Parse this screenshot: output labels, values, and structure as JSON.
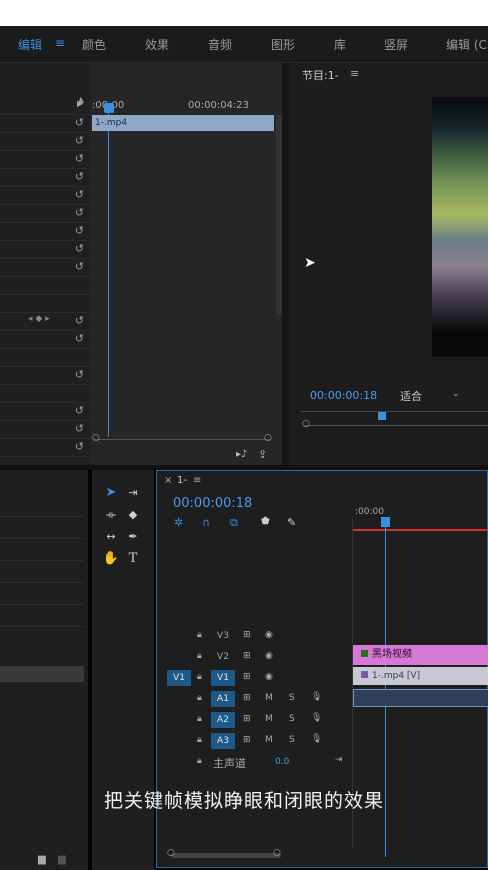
{
  "workspace_tabs": [
    "编辑",
    "≡",
    "颜色",
    "效果",
    "音频",
    "图形",
    "库",
    "竖屏",
    "编辑 (C"
  ],
  "effect_controls": {
    "time_start": ":00:00",
    "time_end": "00:00:04:23",
    "clip_label": "1-.mp4",
    "reset_icon": "↺"
  },
  "program": {
    "title": "节目:1-",
    "menu": "≡",
    "timecode": "00:00:00:18",
    "fit_label": "适合"
  },
  "sequence": {
    "tab_close": "×",
    "tab_name": "1-",
    "tab_menu": "≡",
    "timecode": "00:00:00:18",
    "ruler_time": ":00:00",
    "tracks": [
      {
        "src": "",
        "name": "V3"
      },
      {
        "src": "",
        "name": "V2"
      },
      {
        "src": "V1",
        "name": "V1"
      },
      {
        "src": "",
        "name": "A1"
      },
      {
        "src": "",
        "name": "A2"
      },
      {
        "src": "",
        "name": "A3"
      }
    ],
    "master_label": "主声道",
    "master_value": "0.0",
    "clip_v2": "黑场视频",
    "clip_v1": "1-.mp4 [V]",
    "mute": "M",
    "solo": "S"
  },
  "subtitle": "把关键帧模拟睁眼和闭眼的效果"
}
